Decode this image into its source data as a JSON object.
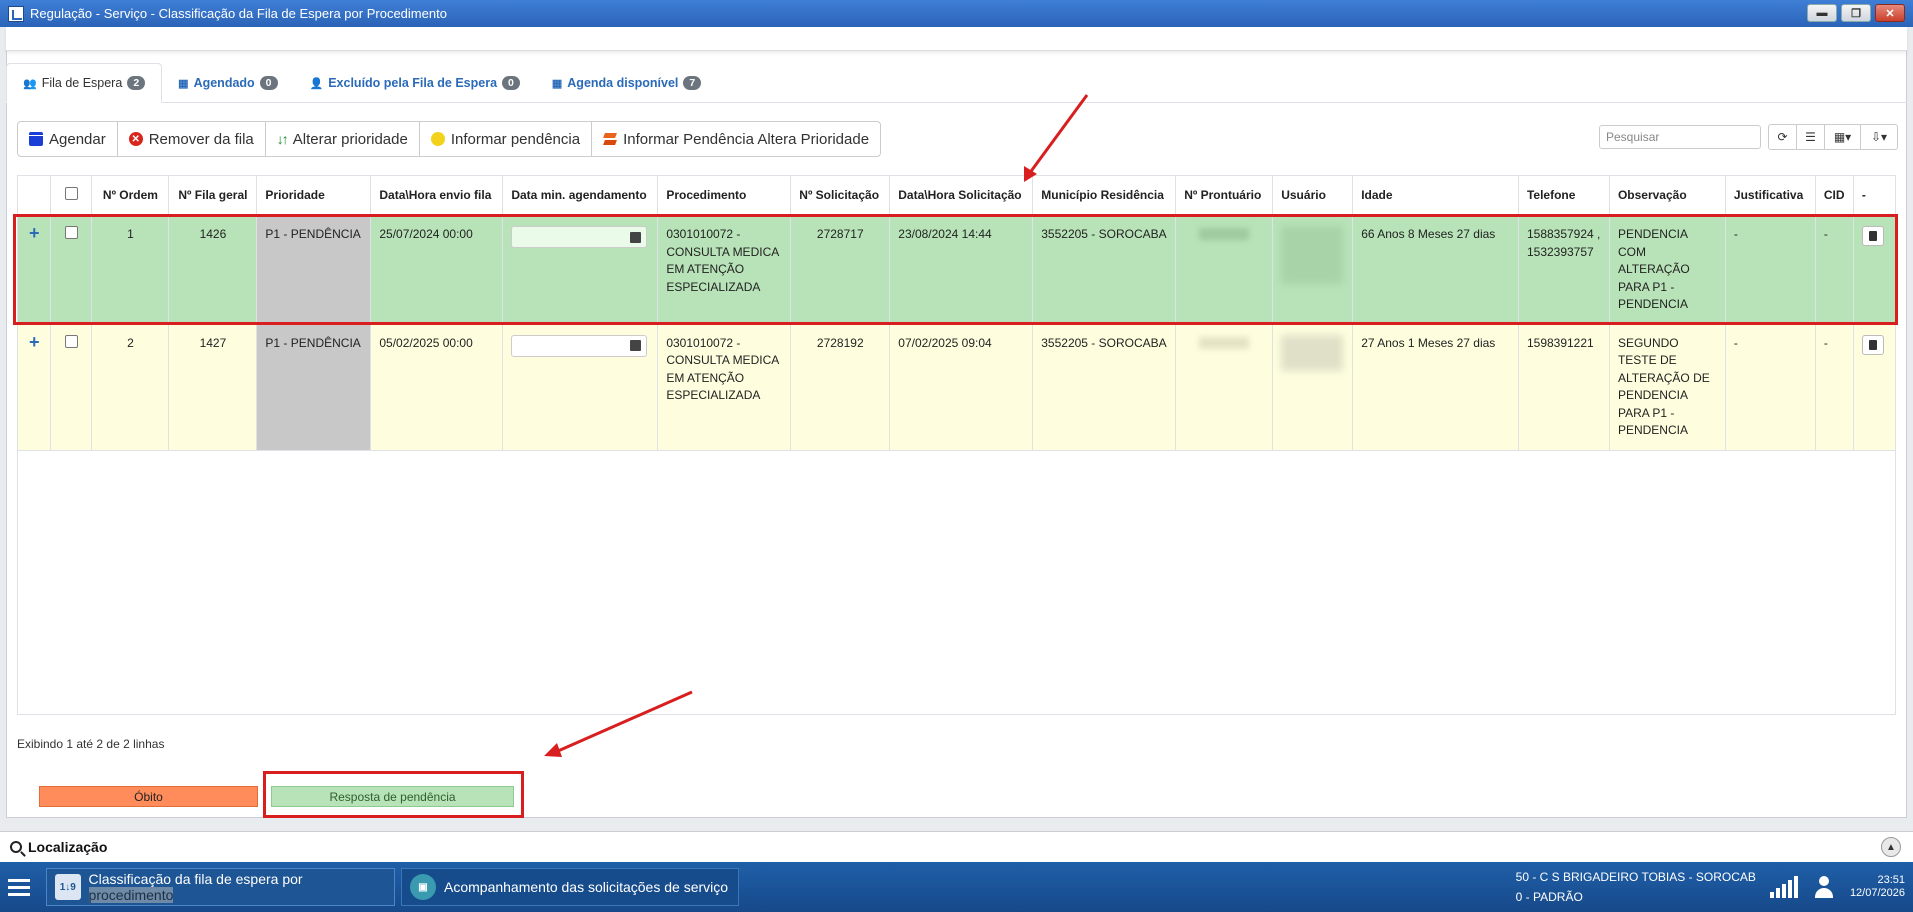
{
  "window": {
    "title": "Regulação - Serviço - Classificação da Fila de Espera por Procedimento",
    "minimize": "▬",
    "maximize": "❐",
    "close": "✕"
  },
  "tabs": [
    {
      "label": "Fila de Espera",
      "count": "2",
      "icon": "users-icon"
    },
    {
      "label": "Agendado",
      "count": "0",
      "icon": "calendar-icon"
    },
    {
      "label": "Excluído pela Fila de Espera",
      "count": "0",
      "icon": "user-minus-icon"
    },
    {
      "label": "Agenda disponível",
      "count": "7",
      "icon": "calendar-icon"
    }
  ],
  "toolbar": {
    "agendar": "Agendar",
    "remover": "Remover da fila",
    "alterar": "Alterar prioridade",
    "informar": "Informar pendência",
    "informar_altera": "Informar Pendência Altera Prioridade"
  },
  "search": {
    "placeholder": "Pesquisar"
  },
  "table": {
    "headers": {
      "ordem": "Nº Ordem",
      "fila_geral": "Nº Fila geral",
      "prioridade": "Prioridade",
      "data_envio": "Data\\Hora envio fila",
      "data_min": "Data min. agendamento",
      "procedimento": "Procedimento",
      "solicitacao": "Nº Solicitação",
      "data_solic": "Data\\Hora Solicitação",
      "municipio": "Município Residência",
      "prontuario": "Nº Prontuário",
      "usuario": "Usuário",
      "idade": "Idade",
      "telefone": "Telefone",
      "observacao": "Observação",
      "justificativa": "Justificativa",
      "cid": "CID",
      "acao": "-"
    },
    "rows": [
      {
        "ordem": "1",
        "fila_geral": "1426",
        "prioridade": "P1 - PENDÊNCIA",
        "data_envio": "25/07/2024 00:00",
        "procedimento": "0301010072 - CONSULTA MEDICA EM ATENÇÃO ESPECIALIZADA",
        "solicitacao": "2728717",
        "data_solic": "23/08/2024 14:44",
        "municipio": "3552205 - SOROCABA",
        "idade": "66 Anos 8 Meses 27 dias",
        "telefone": "1588357924 , 1532393757",
        "observacao": "PENDENCIA COM ALTERAÇÃO PARA P1 - PENDENCIA",
        "justificativa": "-",
        "cid": "-"
      },
      {
        "ordem": "2",
        "fila_geral": "1427",
        "prioridade": "P1 - PENDÊNCIA",
        "data_envio": "05/02/2025 00:00",
        "procedimento": "0301010072 - CONSULTA MEDICA EM ATENÇÃO ESPECIALIZADA",
        "solicitacao": "2728192",
        "data_solic": "07/02/2025 09:04",
        "municipio": "3552205 - SOROCABA",
        "idade": "27 Anos 1 Meses 27 dias",
        "telefone": "1598391221",
        "observacao": "SEGUNDO TESTE DE ALTERAÇÃO DE PENDENCIA PARA P1 - PENDENCIA",
        "justificativa": "-",
        "cid": "-"
      }
    ]
  },
  "footer": {
    "count_text": "Exibindo 1 até 2 de 2 linhas",
    "legend_obito": "Óbito",
    "legend_resposta": "Resposta de pendência"
  },
  "localizacao": {
    "label": "Localização"
  },
  "taskbar": {
    "task1_prefix": "Classificação da fila de espera por ",
    "task1_highlight": "procedimento",
    "task2": "Acompanhamento das solicitações de serviço",
    "unit": "50 - C S BRIGADEIRO TOBIAS - SOROCAB",
    "profile": "0 - PADRÃO",
    "time": "23:51",
    "date": "12/07/2026"
  },
  "colors": {
    "row_highlight": "#b8e3b8",
    "row_normal": "#fefedf",
    "priority_cell": "#c8c8c8",
    "annotation": "#d81e1e",
    "obito": "#ff8c5a"
  }
}
